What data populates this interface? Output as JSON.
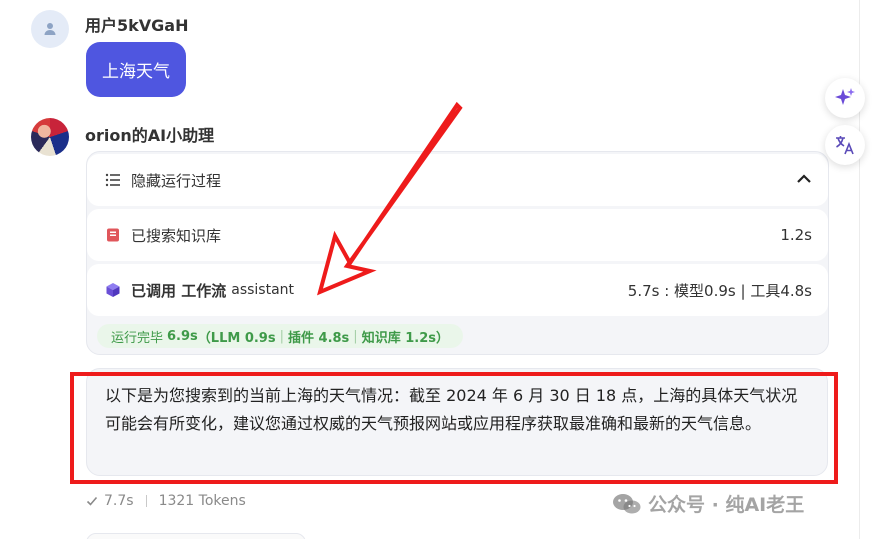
{
  "user": {
    "name": "用户5kVGaH",
    "message": "上海天气"
  },
  "bot": {
    "name": "orion的AI小助理",
    "process": {
      "toggle_label": "隐藏运行过程",
      "steps": [
        {
          "label": "已搜索知识库",
          "time": "1.2s"
        },
        {
          "label_prefix": "已调用 工作流",
          "label_suffix": "assistant",
          "time": "5.7s : 模型0.9s | 工具4.8s"
        }
      ],
      "summary": {
        "prefix": "运行完毕",
        "total": "6.9s",
        "llm": "（LLM 0.9s",
        "plugin": "插件 4.8s",
        "kb": "知识库 1.2s）"
      }
    },
    "answer": "以下是为您搜索到的当前上海的天气情况：截至 2024 年 6 月 30 日 18 点，上海的具体天气状况可能会有所变化，建议您通过权威的天气预报网站或应用程序获取最准确和最新的天气信息。",
    "meta": {
      "time": "7.7s",
      "tokens": "1321 Tokens"
    }
  },
  "watermark": {
    "text": "公众号 · 纯AI老王"
  },
  "colors": {
    "accent": "#4f56e0",
    "annotation_red": "#ee1b1b",
    "success_green": "#3f9a49"
  },
  "icons": [
    "user-icon",
    "list-icon",
    "knowledge-book-icon",
    "workflow-cube-icon",
    "chevron-up-icon",
    "sparkle-icon",
    "translate-icon",
    "check-icon",
    "wechat-icon"
  ]
}
